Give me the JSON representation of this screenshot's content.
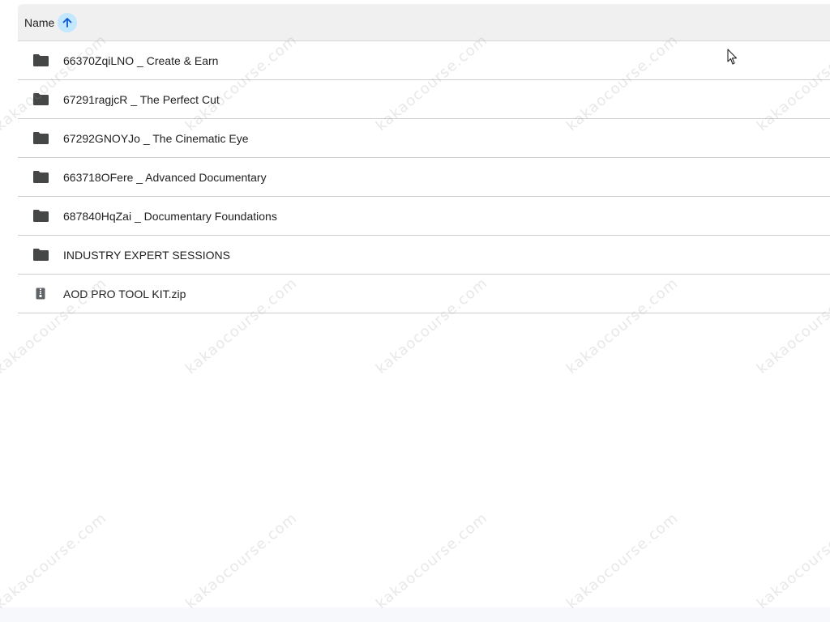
{
  "header": {
    "name_label": "Name",
    "sort_icon": "arrow-up-icon",
    "sort_accent": "#c2e7ff",
    "sort_arrow_color": "#0b57d0"
  },
  "files": [
    {
      "name": "66370ZqiLNO _ Create & Earn",
      "type": "folder",
      "icon": "folder-icon"
    },
    {
      "name": "67291ragjcR _ The Perfect Cut",
      "type": "folder",
      "icon": "folder-icon"
    },
    {
      "name": "67292GNOYJo _ The Cinematic Eye",
      "type": "folder",
      "icon": "folder-icon"
    },
    {
      "name": "663718OFere _ Advanced Documentary",
      "type": "folder",
      "icon": "folder-icon"
    },
    {
      "name": "687840HqZai _ Documentary Foundations",
      "type": "folder",
      "icon": "folder-icon"
    },
    {
      "name": "INDUSTRY EXPERT SESSIONS",
      "type": "folder",
      "icon": "folder-icon"
    },
    {
      "name": "AOD PRO TOOL KIT.zip",
      "type": "zip",
      "icon": "zip-file-icon"
    }
  ],
  "watermark": {
    "text": "kakaocourse.com",
    "color": "#969696"
  },
  "colors": {
    "header_bg": "#f0f0f0",
    "row_divider": "#cfcfcf",
    "icon_color": "#444746",
    "text_color": "#1f1f1f"
  }
}
